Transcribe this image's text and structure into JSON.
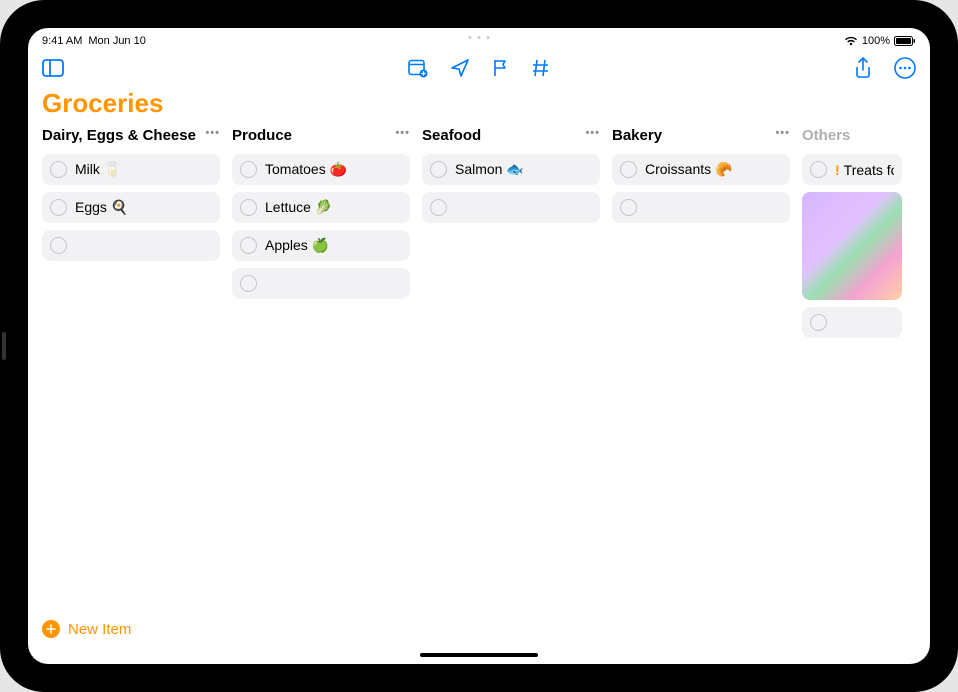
{
  "status": {
    "time": "9:41 AM",
    "date": "Mon Jun 10",
    "battery": "100%"
  },
  "title": "Groceries",
  "columns": [
    {
      "name": "Dairy, Eggs & Cheese",
      "items": [
        {
          "label": "Milk 🥛"
        },
        {
          "label": "Eggs 🍳"
        }
      ]
    },
    {
      "name": "Produce",
      "items": [
        {
          "label": "Tomatoes 🍅"
        },
        {
          "label": "Lettuce 🥬"
        },
        {
          "label": "Apples 🍏"
        }
      ]
    },
    {
      "name": "Seafood",
      "items": [
        {
          "label": "Salmon 🐟"
        }
      ]
    },
    {
      "name": "Bakery",
      "items": [
        {
          "label": "Croissants 🥐"
        }
      ]
    },
    {
      "name": "Others",
      "items": [
        {
          "label": "Treats for t",
          "priority": "!"
        }
      ],
      "has_image": true
    }
  ],
  "footer": {
    "new_item": "New Item"
  }
}
